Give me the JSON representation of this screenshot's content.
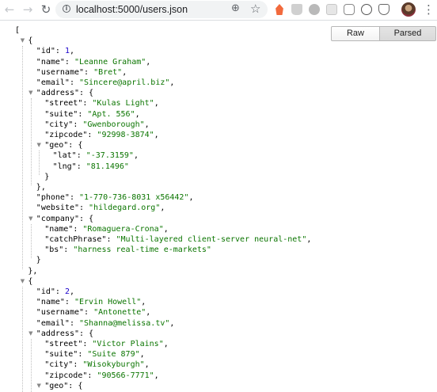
{
  "browser": {
    "url": "localhost:5000/users.json",
    "back_icon": "arrow-left",
    "forward_icon": "arrow-right",
    "reload_icon": "reload",
    "extensions": [
      "extension-flame-icon",
      "extension-cup-icon",
      "extension-tomato-icon",
      "extension-puzzle-icon",
      "extension-bolt-icon",
      "extension-octocat-icon",
      "extension-shield-icon"
    ]
  },
  "viewer": {
    "raw_label": "Raw",
    "parsed_label": "Parsed",
    "active_tab": "Parsed"
  },
  "json_lines": [
    [
      {
        "t": "p",
        "v": "["
      }
    ],
    [
      {
        "t": "p",
        "v": "{"
      }
    ],
    [
      {
        "t": "k",
        "v": "\"id\""
      },
      {
        "t": "p",
        "v": ": "
      },
      {
        "t": "n",
        "v": "1"
      },
      {
        "t": "p",
        "v": ","
      }
    ],
    [
      {
        "t": "k",
        "v": "\"name\""
      },
      {
        "t": "p",
        "v": ": "
      },
      {
        "t": "s",
        "v": "\"Leanne Graham\""
      },
      {
        "t": "p",
        "v": ","
      }
    ],
    [
      {
        "t": "k",
        "v": "\"username\""
      },
      {
        "t": "p",
        "v": ": "
      },
      {
        "t": "s",
        "v": "\"Bret\""
      },
      {
        "t": "p",
        "v": ","
      }
    ],
    [
      {
        "t": "k",
        "v": "\"email\""
      },
      {
        "t": "p",
        "v": ": "
      },
      {
        "t": "s",
        "v": "\"Sincere@april.biz\""
      },
      {
        "t": "p",
        "v": ","
      }
    ],
    [
      {
        "t": "k",
        "v": "\"address\""
      },
      {
        "t": "p",
        "v": ": {"
      }
    ],
    [
      {
        "t": "k",
        "v": "\"street\""
      },
      {
        "t": "p",
        "v": ": "
      },
      {
        "t": "s",
        "v": "\"Kulas Light\""
      },
      {
        "t": "p",
        "v": ","
      }
    ],
    [
      {
        "t": "k",
        "v": "\"suite\""
      },
      {
        "t": "p",
        "v": ": "
      },
      {
        "t": "s",
        "v": "\"Apt. 556\""
      },
      {
        "t": "p",
        "v": ","
      }
    ],
    [
      {
        "t": "k",
        "v": "\"city\""
      },
      {
        "t": "p",
        "v": ": "
      },
      {
        "t": "s",
        "v": "\"Gwenborough\""
      },
      {
        "t": "p",
        "v": ","
      }
    ],
    [
      {
        "t": "k",
        "v": "\"zipcode\""
      },
      {
        "t": "p",
        "v": ": "
      },
      {
        "t": "s",
        "v": "\"92998-3874\""
      },
      {
        "t": "p",
        "v": ","
      }
    ],
    [
      {
        "t": "k",
        "v": "\"geo\""
      },
      {
        "t": "p",
        "v": ": {"
      }
    ],
    [
      {
        "t": "k",
        "v": "\"lat\""
      },
      {
        "t": "p",
        "v": ": "
      },
      {
        "t": "s",
        "v": "\"-37.3159\""
      },
      {
        "t": "p",
        "v": ","
      }
    ],
    [
      {
        "t": "k",
        "v": "\"lng\""
      },
      {
        "t": "p",
        "v": ": "
      },
      {
        "t": "s",
        "v": "\"81.1496\""
      }
    ],
    [
      {
        "t": "p",
        "v": "}"
      }
    ],
    [
      {
        "t": "p",
        "v": "},"
      }
    ],
    [
      {
        "t": "k",
        "v": "\"phone\""
      },
      {
        "t": "p",
        "v": ": "
      },
      {
        "t": "s",
        "v": "\"1-770-736-8031 x56442\""
      },
      {
        "t": "p",
        "v": ","
      }
    ],
    [
      {
        "t": "k",
        "v": "\"website\""
      },
      {
        "t": "p",
        "v": ": "
      },
      {
        "t": "s",
        "v": "\"hildegard.org\""
      },
      {
        "t": "p",
        "v": ","
      }
    ],
    [
      {
        "t": "k",
        "v": "\"company\""
      },
      {
        "t": "p",
        "v": ": {"
      }
    ],
    [
      {
        "t": "k",
        "v": "\"name\""
      },
      {
        "t": "p",
        "v": ": "
      },
      {
        "t": "s",
        "v": "\"Romaguera-Crona\""
      },
      {
        "t": "p",
        "v": ","
      }
    ],
    [
      {
        "t": "k",
        "v": "\"catchPhrase\""
      },
      {
        "t": "p",
        "v": ": "
      },
      {
        "t": "s",
        "v": "\"Multi-layered client-server neural-net\""
      },
      {
        "t": "p",
        "v": ","
      }
    ],
    [
      {
        "t": "k",
        "v": "\"bs\""
      },
      {
        "t": "p",
        "v": ": "
      },
      {
        "t": "s",
        "v": "\"harness real-time e-markets\""
      }
    ],
    [
      {
        "t": "p",
        "v": "}"
      }
    ],
    [
      {
        "t": "p",
        "v": "},"
      }
    ],
    [
      {
        "t": "p",
        "v": "{"
      }
    ],
    [
      {
        "t": "k",
        "v": "\"id\""
      },
      {
        "t": "p",
        "v": ": "
      },
      {
        "t": "n",
        "v": "2"
      },
      {
        "t": "p",
        "v": ","
      }
    ],
    [
      {
        "t": "k",
        "v": "\"name\""
      },
      {
        "t": "p",
        "v": ": "
      },
      {
        "t": "s",
        "v": "\"Ervin Howell\""
      },
      {
        "t": "p",
        "v": ","
      }
    ],
    [
      {
        "t": "k",
        "v": "\"username\""
      },
      {
        "t": "p",
        "v": ": "
      },
      {
        "t": "s",
        "v": "\"Antonette\""
      },
      {
        "t": "p",
        "v": ","
      }
    ],
    [
      {
        "t": "k",
        "v": "\"email\""
      },
      {
        "t": "p",
        "v": ": "
      },
      {
        "t": "s",
        "v": "\"Shanna@melissa.tv\""
      },
      {
        "t": "p",
        "v": ","
      }
    ],
    [
      {
        "t": "k",
        "v": "\"address\""
      },
      {
        "t": "p",
        "v": ": {"
      }
    ],
    [
      {
        "t": "k",
        "v": "\"street\""
      },
      {
        "t": "p",
        "v": ": "
      },
      {
        "t": "s",
        "v": "\"Victor Plains\""
      },
      {
        "t": "p",
        "v": ","
      }
    ],
    [
      {
        "t": "k",
        "v": "\"suite\""
      },
      {
        "t": "p",
        "v": ": "
      },
      {
        "t": "s",
        "v": "\"Suite 879\""
      },
      {
        "t": "p",
        "v": ","
      }
    ],
    [
      {
        "t": "k",
        "v": "\"city\""
      },
      {
        "t": "p",
        "v": ": "
      },
      {
        "t": "s",
        "v": "\"Wisokyburgh\""
      },
      {
        "t": "p",
        "v": ","
      }
    ],
    [
      {
        "t": "k",
        "v": "\"zipcode\""
      },
      {
        "t": "p",
        "v": ": "
      },
      {
        "t": "s",
        "v": "\"90566-7771\""
      },
      {
        "t": "p",
        "v": ","
      }
    ],
    [
      {
        "t": "k",
        "v": "\"geo\""
      },
      {
        "t": "p",
        "v": ": {"
      }
    ]
  ]
}
